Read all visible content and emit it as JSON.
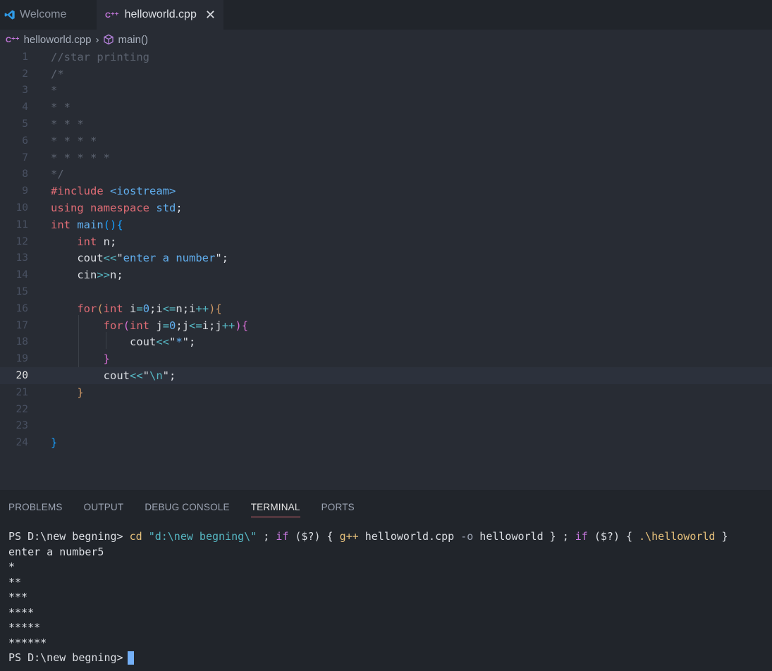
{
  "tabs": [
    {
      "label": "Welcome",
      "icon": "vscode-icon"
    },
    {
      "label": "helloworld.cpp",
      "icon": "cpp-file-icon",
      "close": "✕"
    }
  ],
  "breadcrumb": {
    "file": "helloworld.cpp",
    "symbol": "main()",
    "file_icon_text": "C++"
  },
  "editor": {
    "current_line": 20,
    "line_numbers": [
      "1",
      "2",
      "3",
      "4",
      "5",
      "6",
      "7",
      "8",
      "9",
      "10",
      "11",
      "12",
      "13",
      "14",
      "15",
      "16",
      "17",
      "18",
      "19",
      "20",
      "21",
      "22",
      "23",
      "24"
    ]
  },
  "panel": {
    "tabs": [
      "PROBLEMS",
      "OUTPUT",
      "DEBUG CONSOLE",
      "TERMINAL",
      "PORTS"
    ],
    "active_tab": "TERMINAL",
    "terminal": {
      "prompt": "PS D:\\new begning>",
      "cmd_cd": "cd",
      "cd_arg": "\"d:\\new begning\\\"",
      "semi1": " ; ",
      "if1": "if",
      "cond1": " ($?) { ",
      "gpp": "g++",
      "gpp_args": " helloworld.cpp ",
      "flag": "-o",
      "out": " helloworld } ",
      "semi2": "; ",
      "if2": "if",
      "cond2": " ($?) { ",
      "run": ".\\helloworld",
      "end": " }",
      "output": [
        "enter a number5",
        "*",
        "**",
        "***",
        "****",
        "*****",
        "******"
      ],
      "final_prompt": "PS D:\\new begning>"
    }
  },
  "colors": {
    "accent": "#e06c75",
    "background": "#282c34",
    "cursor": "#74b0f7"
  }
}
